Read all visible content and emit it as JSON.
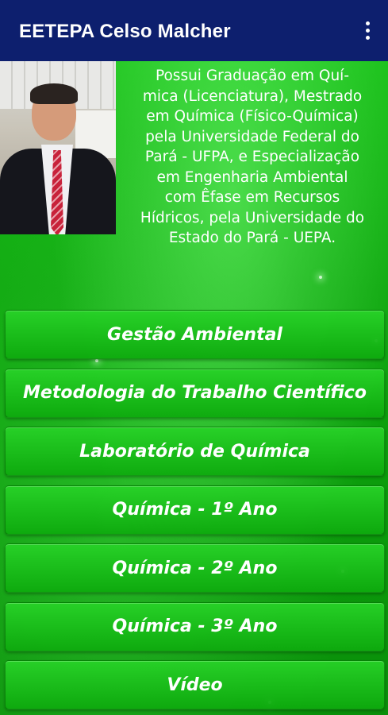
{
  "appbar": {
    "title": "EETEPA Celso Malcher",
    "menu_icon": "more-vert-icon",
    "background_color": "#0d1f6e"
  },
  "profile": {
    "photo_icon": "profile-photo",
    "bio_lines": [
      "Possui Graduação em Quí-",
      "mica (Licenciatura), Mestrado",
      "em Química (Físico-Química)",
      "pela Universidade Federal do",
      "Pará - UFPA, e Especialização",
      "em Engenharia Ambiental",
      "com Êfase em Recursos",
      "Hídricos, pela Universidade do",
      "Estado do Pará - UEPA."
    ]
  },
  "menu": {
    "items": [
      {
        "label": "Gestão Ambiental"
      },
      {
        "label": "Metodologia do Trabalho Científico"
      },
      {
        "label": "Laboratório de Química"
      },
      {
        "label": "Química - 1º Ano"
      },
      {
        "label": "Química - 2º Ano"
      },
      {
        "label": "Química - 3º Ano"
      },
      {
        "label": "Vídeo"
      }
    ]
  },
  "colors": {
    "background": "#0ea60e",
    "button": "#1ab81a",
    "text": "#ffffff"
  }
}
